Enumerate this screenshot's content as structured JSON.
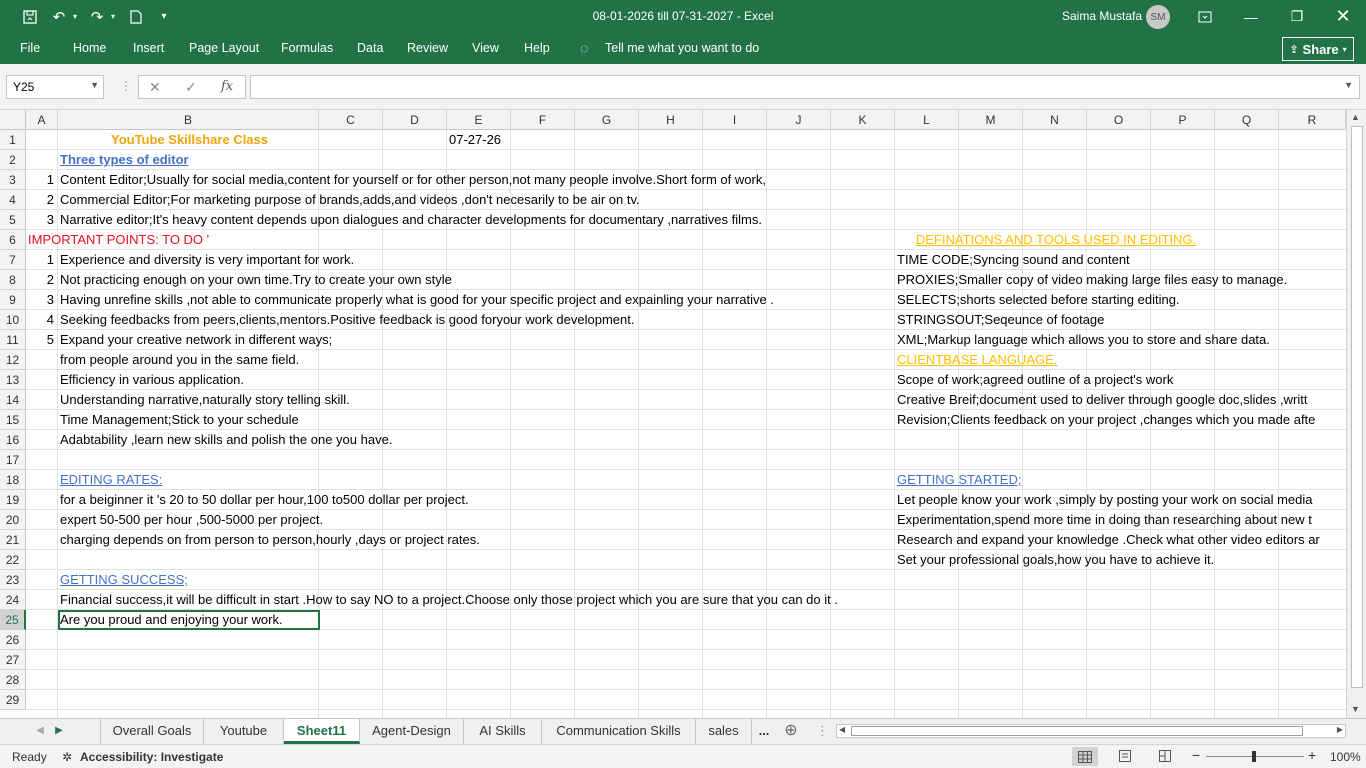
{
  "titlebar": {
    "title": "08-01-2026 till 07-31-2027  -  Excel",
    "user_name": "Saima Mustafa",
    "user_initials": "SM"
  },
  "ribbon": {
    "tabs": [
      "File",
      "Home",
      "Insert",
      "Page Layout",
      "Formulas",
      "Data",
      "Review",
      "View",
      "Help"
    ],
    "tell_me": "Tell me what you want to do",
    "share": "Share"
  },
  "formula_bar": {
    "name_box": "Y25",
    "fx": "fx",
    "value": ""
  },
  "columns": [
    "A",
    "B",
    "C",
    "D",
    "E",
    "F",
    "G",
    "H",
    "I",
    "J",
    "K",
    "L",
    "M",
    "N",
    "O",
    "P",
    "Q",
    "R"
  ],
  "rows": [
    "1",
    "2",
    "3",
    "4",
    "5",
    "6",
    "7",
    "8",
    "9",
    "10",
    "11",
    "12",
    "13",
    "14",
    "15",
    "16",
    "17",
    "18",
    "19",
    "20",
    "21",
    "22",
    "23",
    "24",
    "25",
    "26",
    "27",
    "28",
    "29"
  ],
  "cells": {
    "b1": "YouTube Skillshare Class",
    "e1": "07-27-26",
    "b2": "Three types of editor",
    "a3": "1",
    "b3": "Content Editor;Usually for social media,content for yourself or for other person,not many people involve.Short form of work,",
    "a4": "2",
    "b4": "Commercial Editor;For marketing purpose of brands,adds,and videos ,don't necesarily to be air on tv.",
    "a5": "3",
    "b5": "Narrative editor;It's heavy content depends upon dialogues and character developments for documentary ,narratives films.",
    "a6": "IMPORTANT POINTS: TO DO '",
    "l6": "DEFINATIONS AND TOOLS USED IN EDITING.",
    "a7": "1",
    "b7": "Experience and diversity is very important for work.",
    "l7": "TIME CODE;Syncing sound and content",
    "a8": "2",
    "b8": "Not practicing enough on your own time.Try to create your own style",
    "l8": "PROXIES;Smaller copy of video making large files easy to manage.",
    "a9": "3",
    "b9": "Having unrefine skills ,not able to communicate properly what is good for your specific project and expainling your narrative .",
    "l9": "SELECTS;shorts selected before starting editing.",
    "a10": "4",
    "b10": "Seeking feedbacks from peers,clients,mentors.Positive feedback is good foryour work development.",
    "l10": "STRINGSOUT;Seqeunce of footage",
    "a11": "5",
    "b11": "Expand your creative network in different ways;",
    "l11": "XML;Markup language which allows you to store and share data.",
    "b12": "from people around you in the same field.",
    "l12": "CLIENTBASE LANGUAGE.",
    "b13": "Efficiency in various application.",
    "l13": "Scope of work;agreed outline of a project's work",
    "b14": "Understanding narrative,naturally story telling skill.",
    "l14": "Creative Breif;document used to deliver through google doc,slides ,writt",
    "b15": "Time Management;Stick to your schedule",
    "l15": "Revision;Clients feedback on your project ,changes which you made afte",
    "b16": "Adabtability ,learn new skills and polish the one you have.",
    "b18": "EDITING RATES:",
    "l18": "GETTING STARTED;",
    "b19": "for a beiginner it 's 20 to 50 dollar per hour,100 to500 dollar per project.",
    "l19": "Let people know your work ,simply by posting your work on social media",
    "b20": "expert 50-500 per hour ,500-5000 per project.",
    "l20": "Experimentation,spend more time in doing than researching about new t",
    "b21": "charging depends on from person to person,hourly ,days or project rates.",
    "l21": "Research and expand your knowledge .Check what other video editors ar",
    "l22": "Set your professional goals,how you have to achieve it.",
    "b23": "GETTING SUCCESS;",
    "b24": "Financial success,it will be difficult in start .How to say NO to a project.Choose only those project which you are sure that you can do it .",
    "b25": "Are you proud and enjoying your work."
  },
  "sheets": [
    "Overall Goals",
    "Youtube",
    "Sheet11",
    "Agent-Design",
    "AI Skills",
    "Communication Skills",
    "sales",
    "..."
  ],
  "active_sheet": "Sheet11",
  "status": {
    "ready": "Ready",
    "accessibility": "Accessibility: Investigate",
    "zoom": "100%"
  }
}
